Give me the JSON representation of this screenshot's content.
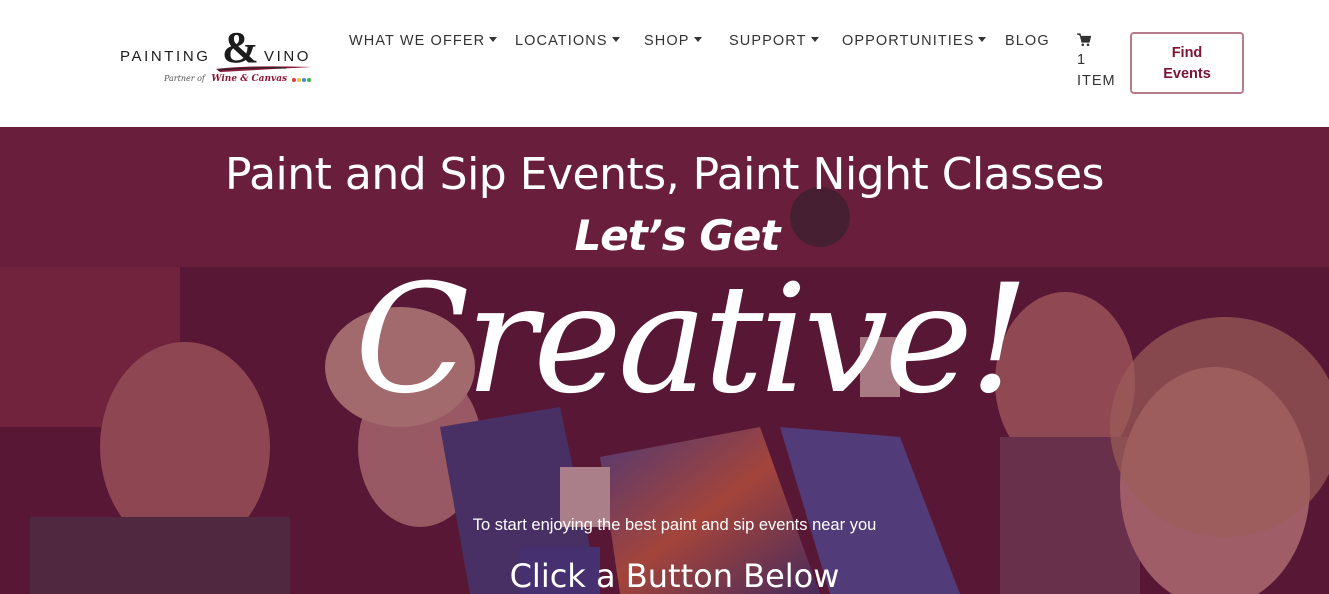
{
  "header": {
    "logo": {
      "text_left": "PAINTING",
      "ampersand": "&",
      "text_right": "VINO",
      "partner_prefix": "Partner of",
      "partner_brand": "Wine & Canvas",
      "icon": "painting-and-vino-logo"
    },
    "nav": [
      {
        "label": "WHAT WE OFFER",
        "has_dropdown": true
      },
      {
        "label": "LOCATIONS",
        "has_dropdown": true
      },
      {
        "label": "SHOP",
        "has_dropdown": true
      },
      {
        "label": "SUPPORT",
        "has_dropdown": true
      },
      {
        "label": "OPPORTUNITIES",
        "has_dropdown": true
      },
      {
        "label": "BLOG",
        "has_dropdown": false
      }
    ],
    "cart": {
      "icon": "cart-icon",
      "count": "1",
      "unit": "ITEM"
    },
    "cta": {
      "line1": "Find",
      "line2": "Events"
    }
  },
  "hero": {
    "title": "Paint and Sip Events, Paint Night Classes",
    "subtitle": "Let’s Get",
    "script_word": "Creative!",
    "body": "To start enjoying the best paint and sip events near you",
    "cta_title": "Click a Button Below"
  },
  "colors": {
    "brand": "#7a1534",
    "button_border": "#b77c8a",
    "overlay": "#69143c",
    "nav_text": "#333333"
  }
}
